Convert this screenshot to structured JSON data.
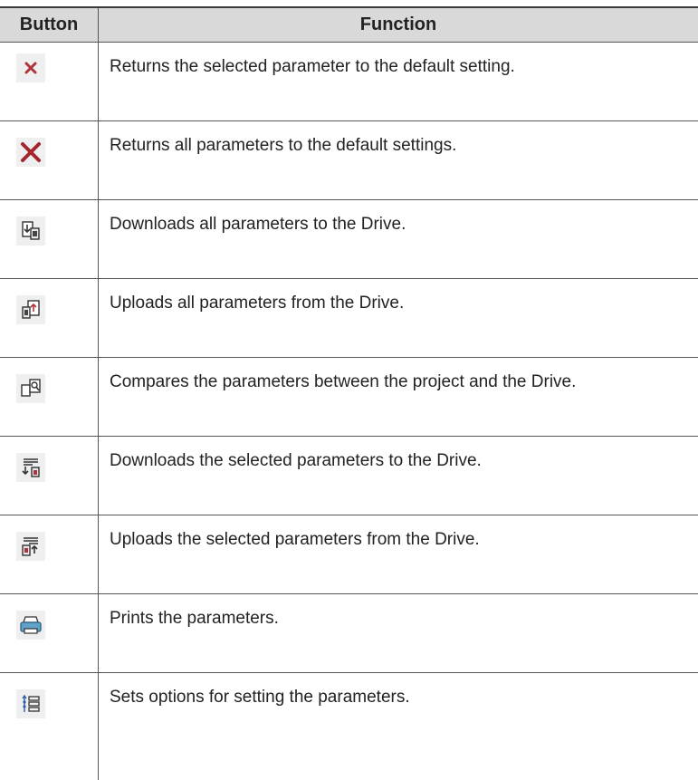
{
  "table": {
    "header": {
      "button": "Button",
      "function": "Function"
    },
    "rows": [
      {
        "icon": "close-x-small-icon",
        "function": "Returns the selected parameter to the default setting."
      },
      {
        "icon": "close-x-large-icon",
        "function": "Returns all parameters to the default settings."
      },
      {
        "icon": "download-all-icon",
        "function": "Downloads all parameters to the Drive."
      },
      {
        "icon": "upload-all-icon",
        "function": "Uploads all parameters from the Drive."
      },
      {
        "icon": "compare-icon",
        "function": "Compares the parameters between the project and the Drive."
      },
      {
        "icon": "download-selected-icon",
        "function": "Downloads the selected parameters to the Drive."
      },
      {
        "icon": "upload-selected-icon",
        "function": "Uploads the selected parameters from the Drive."
      },
      {
        "icon": "print-icon",
        "function": "Prints the parameters."
      },
      {
        "icon": "options-icon",
        "function": "Sets options for setting the parameters."
      }
    ]
  }
}
